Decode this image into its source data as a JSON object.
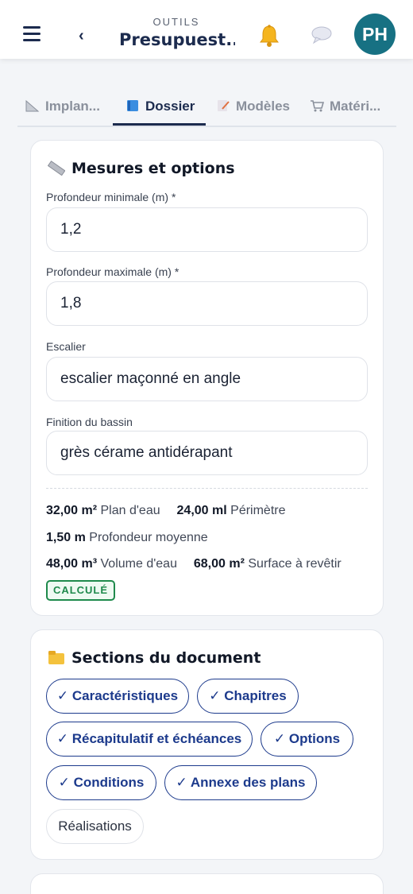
{
  "header": {
    "menu_icon": "hamburger-icon",
    "back_icon": "chevron-left-icon",
    "back_glyph": "‹",
    "supertitle": "OUTILS",
    "title": "Presupuest...",
    "notification_icon": "bell-icon",
    "messages_icon": "chat-bubble-icon",
    "avatar_initials": "PH",
    "avatar_color": "#177183"
  },
  "tabs": [
    {
      "label": "Implan...",
      "icon": "ruler-triangle-icon",
      "active": false
    },
    {
      "label": "Dossier",
      "icon": "blue-book-icon",
      "active": true
    },
    {
      "label": "Modèles",
      "icon": "memo-icon",
      "active": false
    },
    {
      "label": "Matéri...",
      "icon": "shopping-cart-icon",
      "active": false
    }
  ],
  "measures": {
    "title": "Mesures et options",
    "icon": "ruler-icon",
    "fields": [
      {
        "label": "Profondeur minimale (m) *",
        "value": "1,2"
      },
      {
        "label": "Profondeur maximale (m) *",
        "value": "1,8"
      },
      {
        "label": "Escalier",
        "value": "escalier maçonné en angle"
      },
      {
        "label": "Finition du bassin",
        "value": "grès cérame antidérapant"
      }
    ],
    "stats": {
      "water_area_value": "32,00 m²",
      "water_area_label": "Plan d'eau",
      "perimeter_value": "24,00 ml",
      "perimeter_label": "Périmètre",
      "avg_depth_value": "1,50 m",
      "avg_depth_label": "Profondeur moyenne",
      "volume_value": "48,00 m³",
      "volume_label": "Volume d'eau",
      "surface_value": "68,00 m²",
      "surface_label": "Surface à revêtir"
    },
    "status_badge": "CALCULÉ",
    "status_color": "#1f8a4c"
  },
  "sections": {
    "title": "Sections du document",
    "icon": "card-index-dividers-icon",
    "chips": [
      {
        "label": "✓ Caractéristiques",
        "selected": true
      },
      {
        "label": "✓ Chapitres",
        "selected": true
      },
      {
        "label": "✓ Récapitulatif et échéances",
        "selected": true
      },
      {
        "label": "✓ Options",
        "selected": true
      },
      {
        "label": "✓ Conditions",
        "selected": true
      },
      {
        "label": "✓ Annexe des plans",
        "selected": true
      },
      {
        "label": "Réalisations",
        "selected": false
      }
    ],
    "accent_color": "#1c3a8c"
  }
}
